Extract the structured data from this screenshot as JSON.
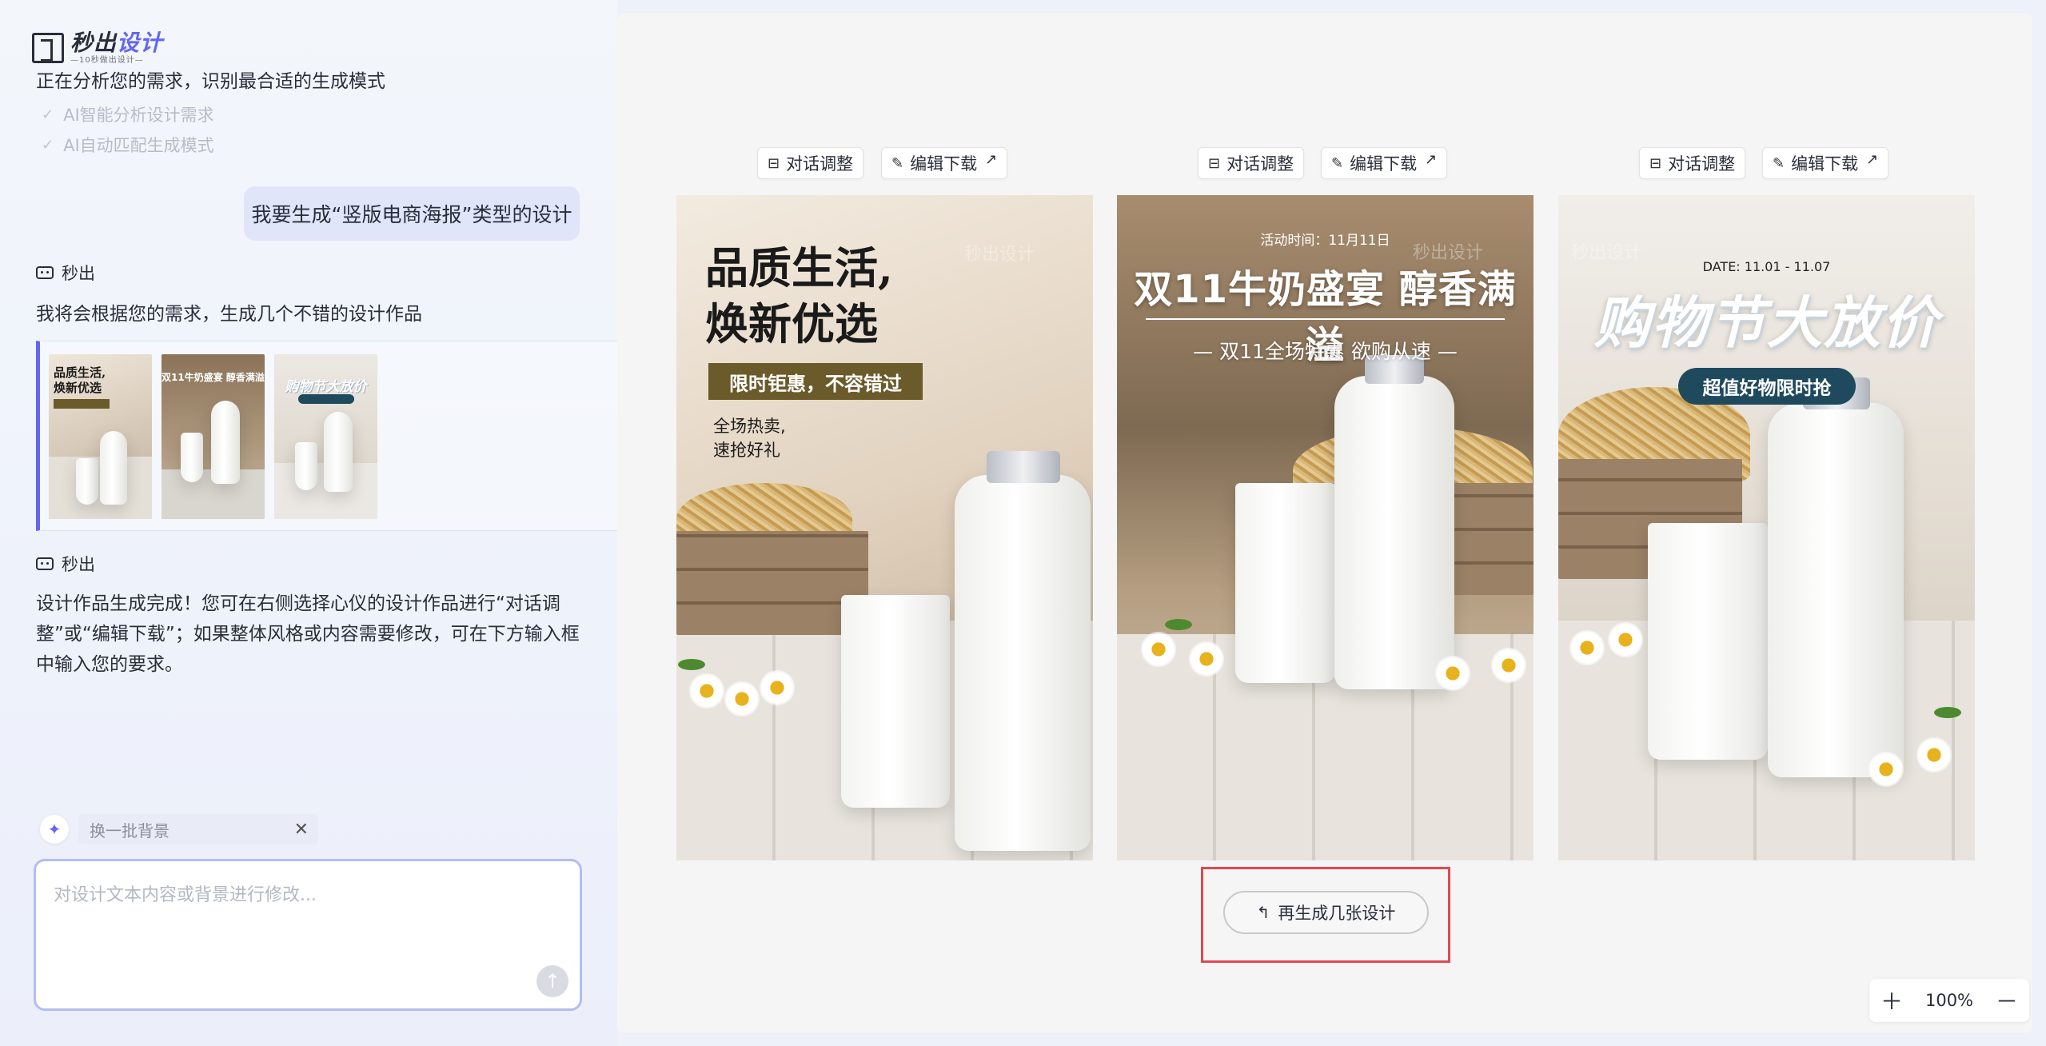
{
  "app": {
    "logo_name_a": "秒出",
    "logo_name_b": "设计",
    "logo_slogan": "—10秒做出设计—"
  },
  "chat": {
    "status": "正在分析您的需求，识别最合适的生成模式",
    "checks": [
      "AI智能分析设计需求",
      "AI自动匹配生成模式"
    ],
    "user_message": "我要生成“竖版电商海报”类型的设计",
    "bot_name": "秒出",
    "bot_message_1": "我将会根据您的需求，生成几个不错的设计作品",
    "bot_message_2": "设计作品生成完成！您可在右侧选择心仪的设计作品进行“对话调整”或“编辑下载”；如果整体风格或内容需要修改，可在下方输入框中输入您的要求。",
    "chip_label": "换一批背景",
    "input_placeholder": "对设计文本内容或背景进行修改..."
  },
  "canvas": {
    "adjust_label": "对话调整",
    "download_label": "编辑下载",
    "regen_label": "再生成几张设计",
    "zoom_level": "100%",
    "watermark": "秒出设计"
  },
  "posters": [
    {
      "title_line1": "品质生活,",
      "title_line2": "焕新优选",
      "band": "限时钜惠，不容错过",
      "sub_line1": "全场热卖,",
      "sub_line2": "速抢好礼"
    },
    {
      "date": "活动时间：11月11日",
      "title": "双11牛奶盛宴  醇香满溢",
      "sub": "— 双11全场特惠 欲购从速 —"
    },
    {
      "date": "DATE: 11.01 - 11.07",
      "title": "购物节大放价",
      "badge": "超值好物限时抢"
    }
  ],
  "colors": {
    "accent": "#6266f0",
    "highlight_border": "#e3484d",
    "user_bubble": "#e0e5fa"
  },
  "icons": {
    "adjust": "chat-edit-icon",
    "download": "edit-icon",
    "external": "arrow-up-right-icon",
    "regen": "return-arrow-icon",
    "send": "arrow-up-icon",
    "spark": "sparkle-icon",
    "close": "close-icon"
  }
}
